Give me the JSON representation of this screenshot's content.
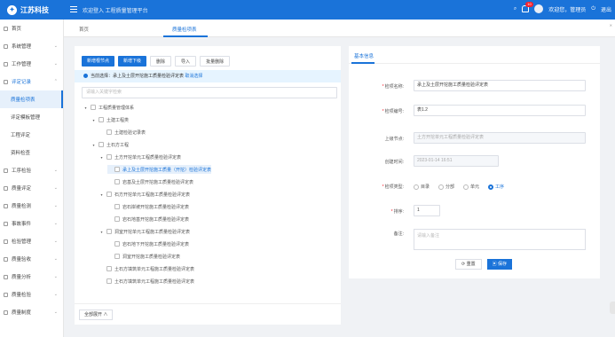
{
  "header": {
    "brand": "江苏科技",
    "welcome": "欢迎登入 工程质量管理平台",
    "badge": "10",
    "user": "欢迎您，管理员",
    "logout": "退出"
  },
  "sidebar": [
    {
      "label": "首页",
      "type": "top"
    },
    {
      "label": "系统管理",
      "type": "top",
      "arrow": "⌄"
    },
    {
      "label": "工作管理",
      "type": "top",
      "arrow": "⌄"
    },
    {
      "label": "评定记录",
      "type": "open",
      "arrow": "⌃"
    },
    {
      "label": "质量检项表",
      "type": "active"
    },
    {
      "label": "评定模板管理",
      "type": "sub"
    },
    {
      "label": "工程评定",
      "type": "sub"
    },
    {
      "label": "资料检查",
      "type": "sub"
    },
    {
      "label": "工序检验",
      "type": "top",
      "arrow": "⌄"
    },
    {
      "label": "质量评定",
      "type": "top",
      "arrow": "⌄"
    },
    {
      "label": "质量检测",
      "type": "top",
      "arrow": "⌄"
    },
    {
      "label": "事故事件",
      "type": "top",
      "arrow": "⌄"
    },
    {
      "label": "检验管理",
      "type": "top",
      "arrow": "⌄"
    },
    {
      "label": "质量验收",
      "type": "top",
      "arrow": "⌄"
    },
    {
      "label": "质量分析",
      "type": "top",
      "arrow": "⌄"
    },
    {
      "label": "质量检验",
      "type": "top",
      "arrow": "⌄"
    },
    {
      "label": "质量制度",
      "type": "top",
      "arrow": "⌄"
    }
  ],
  "tabs": [
    "首页",
    "质量检项表"
  ],
  "toolbar": {
    "b1": "新增根节点",
    "b2": "新增下级",
    "b3": "删除",
    "b4": "导入",
    "b5": "批量删除"
  },
  "tip": {
    "text": "当前选择：",
    "value": "承上及土层开挖施工质量检验评定表",
    "link": "取消选择"
  },
  "search_placeholder": "请输入关键字检索",
  "tree": [
    {
      "level": 0,
      "label": "工程质量管理体系",
      "caret": "▾"
    },
    {
      "level": 1,
      "label": "土建工程类",
      "caret": "▾"
    },
    {
      "level": 2,
      "label": "土建检验记录表",
      "caret": ""
    },
    {
      "level": 1,
      "label": "土石方工程",
      "caret": "▾"
    },
    {
      "level": 2,
      "label": "土方开挖单元工程质量检验评定表",
      "caret": "▾"
    },
    {
      "level": 3,
      "label": "承上及土层开挖施工质量（开挖）检验评定表",
      "caret": "",
      "sel": true
    },
    {
      "level": 3,
      "label": "岩基及土层开挖施工质量检验评定表",
      "caret": ""
    },
    {
      "level": 2,
      "label": "石方开挖单元工程施工质量检验评定表",
      "caret": "▾"
    },
    {
      "level": 3,
      "label": "岩石岸坡开挖施工质量检验评定表",
      "caret": ""
    },
    {
      "level": 3,
      "label": "岩石地基开挖施工质量检验评定表",
      "caret": ""
    },
    {
      "level": 2,
      "label": "洞室开挖单元工程施工质量检验评定表",
      "caret": "▾"
    },
    {
      "level": 3,
      "label": "岩石地下开挖施工质量检验评定表",
      "caret": ""
    },
    {
      "level": 3,
      "label": "洞室开挖施工质量检验评定表",
      "caret": ""
    },
    {
      "level": 2,
      "label": "土石方填筑单元工程施工质量检验评定表",
      "caret": ""
    },
    {
      "level": 2,
      "label": "土石方填筑单元工程施工质量检验评定表",
      "caret": ""
    }
  ],
  "expand_label": "全部展开 ∧",
  "panel": {
    "title": "基本信息",
    "name_label": "检项名称:",
    "name_value": "承上及土层开挖施工质量检验评定表",
    "code_label": "检项编号:",
    "code_value": "表1.2",
    "parent_label": "上级节点:",
    "parent_value": "土方开挖单元工程质量检验评定表",
    "time_label": "创建时间:",
    "time_value": "2023-01-14 16:51",
    "type_label": "检项类型:",
    "types": [
      "目录",
      "分部",
      "单元",
      "工序"
    ],
    "type_selected": 3,
    "sort_label": "排序:",
    "sort_value": "1",
    "note_label": "备注:",
    "note_placeholder": "请输入备注",
    "reset": "重置",
    "save": "保存"
  }
}
